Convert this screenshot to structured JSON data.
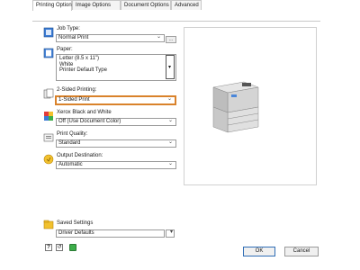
{
  "tabs": [
    {
      "label": "Printing Options"
    },
    {
      "label": "Image Options"
    },
    {
      "label": "Document Options"
    },
    {
      "label": "Advanced"
    }
  ],
  "job_type": {
    "label": "Job Type:",
    "value": "Normal Print",
    "more_label": "..."
  },
  "paper": {
    "label": "Paper:",
    "lines": [
      "Letter (8.5 x 11\")",
      "White",
      "Printer Default Type"
    ]
  },
  "two_sided": {
    "label": "2-Sided Printing:",
    "value": "1-Sided Print",
    "highlight_color": "#d9822b"
  },
  "color_mode": {
    "label": "Xerox Black and White",
    "value": "Off (Use Document Color)"
  },
  "print_quality": {
    "label": "Print Quality:",
    "value": "Standard"
  },
  "output_destination": {
    "label": "Output Destination:",
    "value": "Automatic"
  },
  "saved_settings": {
    "label": "Saved Settings",
    "value": "Driver Defaults"
  },
  "buttons": {
    "ok": "OK",
    "cancel": "Cancel"
  },
  "icons": [
    "job-type-icon",
    "paper-icon",
    "two-sided-icon",
    "color-icon",
    "quality-icon",
    "output-icon",
    "saved-settings-icon",
    "help-icon",
    "reset-icon",
    "status-icon"
  ],
  "colors": {
    "accent": "#2f6db5",
    "highlight": "#d9822b"
  }
}
